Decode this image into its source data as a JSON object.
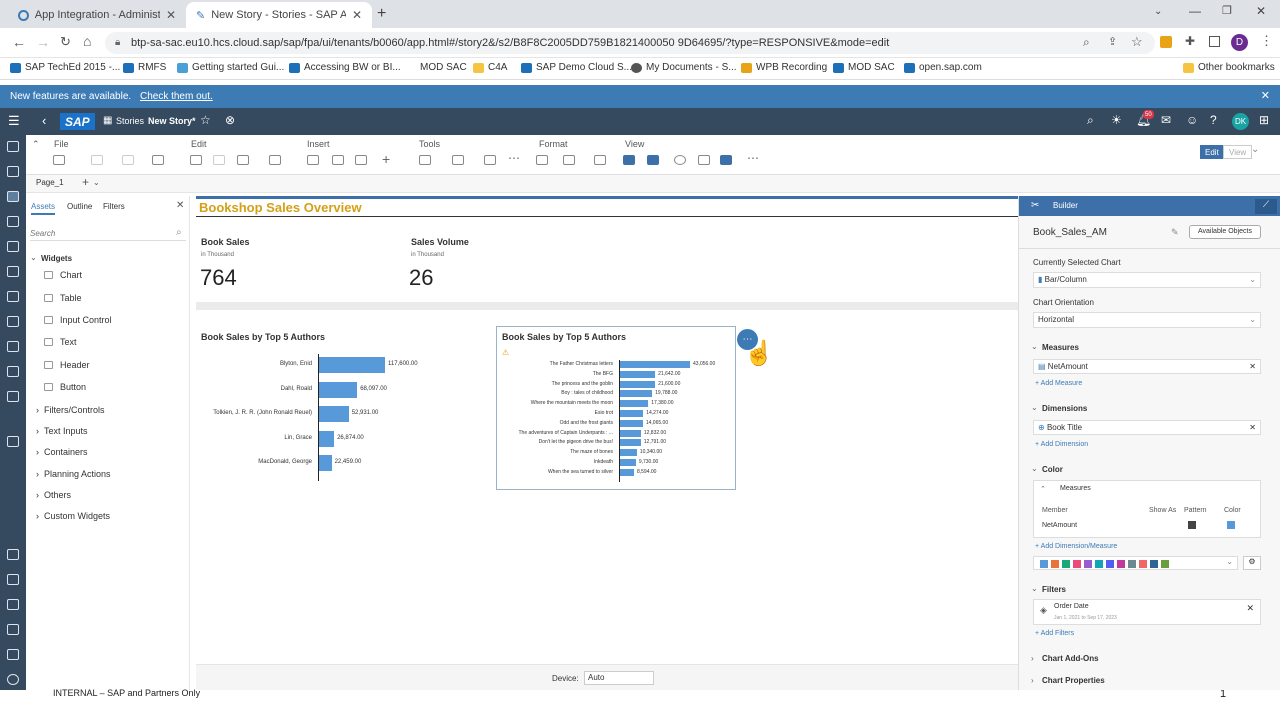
{
  "browser": {
    "tabs": [
      {
        "title": "App Integration - Administration"
      },
      {
        "title": "New Story - Stories - SAP Analyt"
      }
    ],
    "url": "btp-sa-sac.eu10.hcs.cloud.sap/sap/fpa/ui/tenants/b0060/app.html#/story2&/s2/B8F8C2005DD759B1821400050 9D64695/?type=RESPONSIVE&mode=edit",
    "profile_initial": "D",
    "bookmarks": [
      "SAP TechEd 2015 -...",
      "RMFS",
      "Getting started Gui...",
      "Accessing BW or BI...",
      "MOD SAC",
      "C4A",
      "SAP Demo Cloud S...",
      "My Documents - S...",
      "WPB Recording",
      "MOD SAC",
      "open.sap.com"
    ],
    "other_bookmarks": "Other bookmarks"
  },
  "banner": {
    "text": "New features are available.",
    "link": "Check them out."
  },
  "shell": {
    "logo": "SAP",
    "breadcrumb_stories": "Stories",
    "story_title": "New Story*",
    "notifications_count": "50",
    "user_initials": "DK"
  },
  "toolbar": {
    "groups": [
      "File",
      "Edit",
      "Insert",
      "Tools",
      "Format",
      "View"
    ],
    "mode_edit": "Edit",
    "mode_view": "View"
  },
  "page_tab": "Page_1",
  "left_panel": {
    "tabs": [
      "Assets",
      "Outline",
      "Filters"
    ],
    "search_placeholder": "Search",
    "widgets_title": "Widgets",
    "widgets": [
      "Chart",
      "Table",
      "Input Control",
      "Text",
      "Header",
      "Button"
    ],
    "groups": [
      "Filters/Controls",
      "Text Inputs",
      "Containers",
      "Planning Actions",
      "Others",
      "Custom Widgets"
    ]
  },
  "canvas": {
    "title": "Bookshop Sales Overview",
    "kpis": [
      {
        "label": "Book Sales",
        "unit": "in Thousand",
        "value": "764"
      },
      {
        "label": "Sales Volume",
        "unit": "in Thousand",
        "value": "26"
      }
    ],
    "chart1_title": "Book Sales by Top 5 Authors",
    "chart2_title": "Book Sales by Top 5 Authors"
  },
  "chart_data": [
    {
      "type": "bar",
      "title": "Book Sales by Top 5 Authors",
      "categories": [
        "Blyton, Enid",
        "Dahl, Roald",
        "Tolkien, J. R. R. (John Ronald Reuel)",
        "Lin, Grace",
        "MacDonald, George"
      ],
      "values": [
        117600,
        68097,
        52931,
        26874,
        22459
      ],
      "labels": [
        "117,600.00",
        "68,097.00",
        "52,931.00",
        "26,874.00",
        "22,459.00"
      ]
    },
    {
      "type": "bar",
      "title": "Book Sales by Top 5 Authors",
      "categories": [
        "The Father Christmas letters",
        "The BFG",
        "The princess and the goblin",
        "Boy : tales of childhood",
        "Where the mountain meets the moon",
        "Esio trot",
        "Odd and the frost giants",
        "The adventures of Captain Underpants : ...",
        "Don't let the pigeon drive the bus!",
        "The maze of bones",
        "Inkdeath",
        "When the sea turned to silver"
      ],
      "values": [
        43056,
        21642,
        21600,
        19788,
        17380,
        14274,
        14065,
        12832,
        12791,
        10340,
        9730,
        8594
      ],
      "labels": [
        "43,056.00",
        "21,642.00",
        "21,600.00",
        "19,788.00",
        "17,380.00",
        "14,274.00",
        "14,065.00",
        "12,832.00",
        "12,791.00",
        "10,340.00",
        "9,730.00",
        "8,594.00"
      ]
    }
  ],
  "builder": {
    "header": "Builder",
    "model": "Book_Sales_AM",
    "available_objects": "Available Objects",
    "selected_chart_label": "Currently Selected Chart",
    "selected_chart": "Bar/Column",
    "orientation_label": "Chart Orientation",
    "orientation": "Horizontal",
    "measures_title": "Measures",
    "measure": "NetAmount",
    "add_measure": "+ Add Measure",
    "dimensions_title": "Dimensions",
    "dimension": "Book Title",
    "add_dimension": "+ Add Dimension",
    "color_title": "Color",
    "color_measures": "Measures",
    "col_member": "Member",
    "col_show_as": "Show As",
    "col_pattern": "Pattern",
    "col_color": "Color",
    "color_member": "NetAmount",
    "add_dim_measure": "+ Add Dimension/Measure",
    "palette": [
      "#5899da",
      "#e8743b",
      "#19a979",
      "#ed4a7b",
      "#945ecf",
      "#13a4b4",
      "#525df4",
      "#bf399e",
      "#6c8893",
      "#ee6868",
      "#2f6497",
      "#6a9e3c"
    ],
    "filters_title": "Filters",
    "filter_name": "Order Date",
    "filter_range": "Jan 1, 2021 to Sep 17, 2023",
    "add_filters": "+ Add Filters",
    "addons": "Chart Add-Ons",
    "properties": "Chart Properties"
  },
  "footer": {
    "device_label": "Device:",
    "device_value": "Auto",
    "internal": "INTERNAL – SAP and Partners Only",
    "page_number": "1"
  }
}
